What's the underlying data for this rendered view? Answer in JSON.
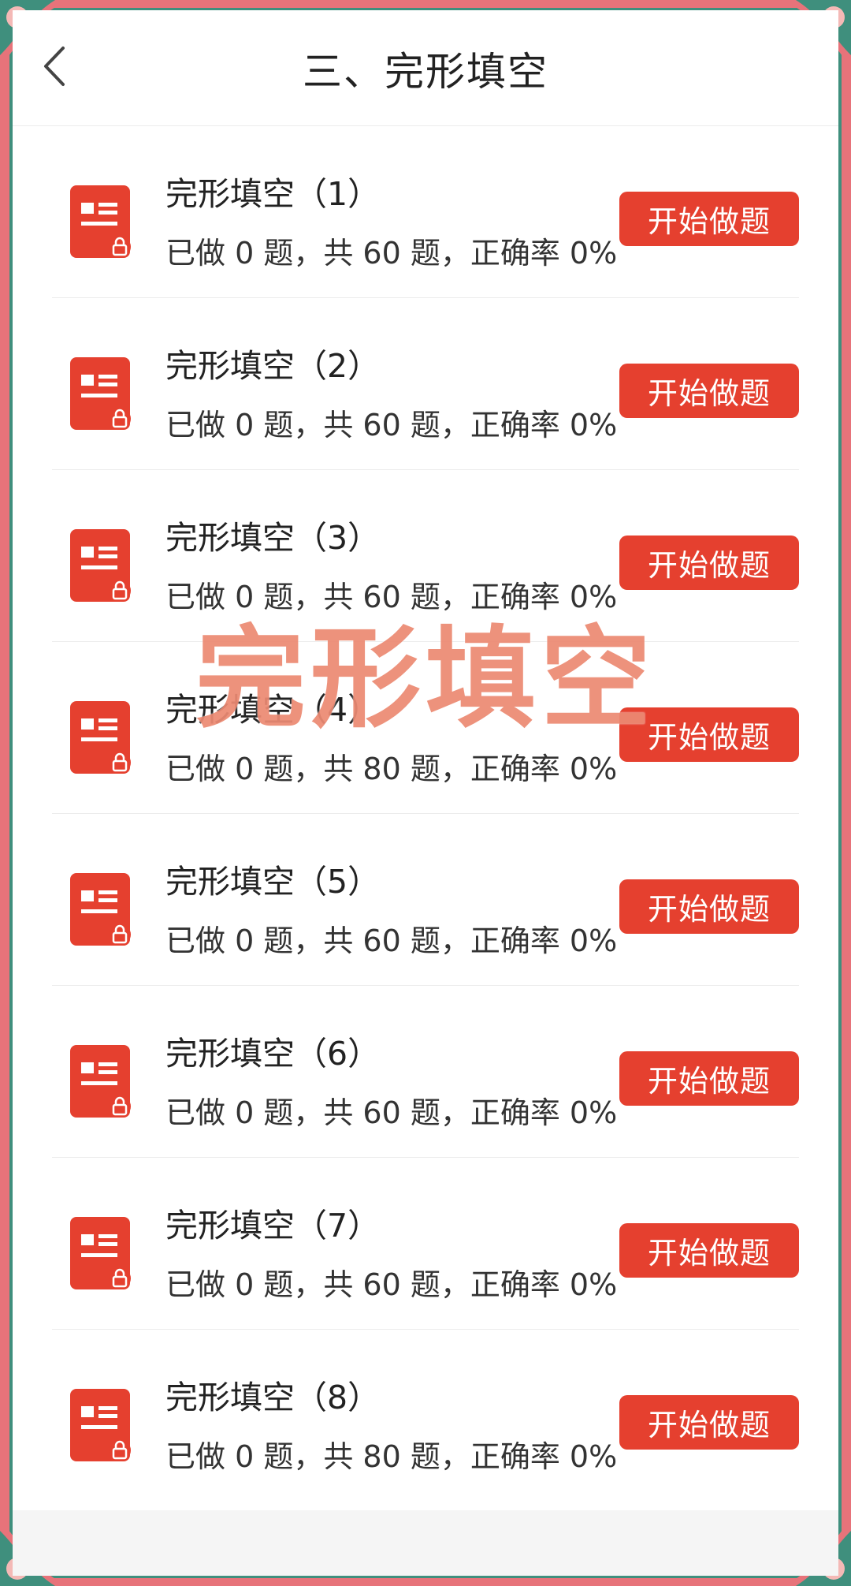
{
  "header": {
    "title": "三、完形填空"
  },
  "items": [
    {
      "title": "完形填空（1）",
      "stats": "已做 0 题，共 60 题，正确率 0%",
      "button": "开始做题"
    },
    {
      "title": "完形填空（2）",
      "stats": "已做 0 题，共 60 题，正确率 0%",
      "button": "开始做题"
    },
    {
      "title": "完形填空（3）",
      "stats": "已做 0 题，共 60 题，正确率 0%",
      "button": "开始做题"
    },
    {
      "title": "完形填空（4）",
      "stats": "已做 0 题，共 80 题，正确率 0%",
      "button": "开始做题"
    },
    {
      "title": "完形填空（5）",
      "stats": "已做 0 题，共 60 题，正确率 0%",
      "button": "开始做题"
    },
    {
      "title": "完形填空（6）",
      "stats": "已做 0 题，共 60 题，正确率 0%",
      "button": "开始做题"
    },
    {
      "title": "完形填空（7）",
      "stats": "已做 0 题，共 60 题，正确率 0%",
      "button": "开始做题"
    },
    {
      "title": "完形填空（8）",
      "stats": "已做 0 题，共 80 题，正确率 0%",
      "button": "开始做题"
    }
  ],
  "overlay": {
    "watermark": "完形填空"
  },
  "colors": {
    "accent": "#e5402f",
    "frame_pink": "#e7737a",
    "frame_green": "#3f8f7d",
    "watermark": "#ec8a73"
  },
  "icons": {
    "back": "chevron-left-icon",
    "item": "locked-document-icon"
  }
}
